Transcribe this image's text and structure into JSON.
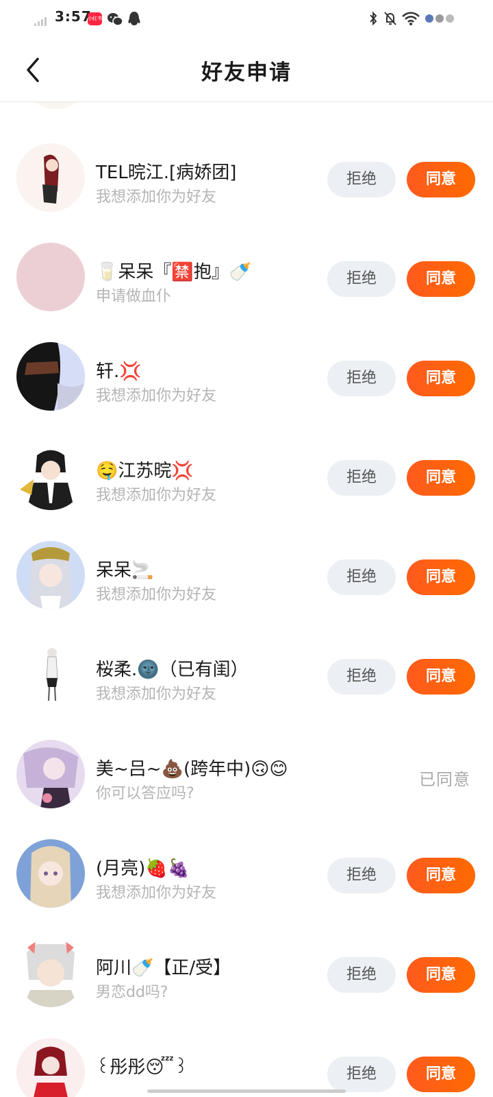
{
  "status_bar": {
    "time": "3:57",
    "app_icon_text": "小红书"
  },
  "header": {
    "title": "好友申请"
  },
  "requests": [
    {
      "name": "TEL晥江.[病娇团]",
      "message": "我想添加你为好友",
      "reject_label": "拒绝",
      "accept_label": "同意"
    },
    {
      "name": "🥛呆呆『🈲抱』🍼",
      "message": "申请做血仆",
      "reject_label": "拒绝",
      "accept_label": "同意"
    },
    {
      "name": "轩.💢",
      "message": "我想添加你为好友",
      "reject_label": "拒绝",
      "accept_label": "同意"
    },
    {
      "name": "🤤江苏晥💢",
      "message": "我想添加你为好友",
      "reject_label": "拒绝",
      "accept_label": "同意"
    },
    {
      "name": "呆呆🚬",
      "message": "我想添加你为好友",
      "reject_label": "拒绝",
      "accept_label": "同意"
    },
    {
      "name": "桜柔.🌚（已有闺）",
      "message": "我想添加你为好友",
      "reject_label": "拒绝",
      "accept_label": "同意"
    },
    {
      "name": "美~吕~💩(跨年中)🙃😊",
      "message": "你可以答应吗?",
      "status_label": "已同意"
    },
    {
      "name": "(月亮)🍓🍇",
      "message": "我想添加你为好友",
      "reject_label": "拒绝",
      "accept_label": "同意"
    },
    {
      "name": "阿川🍼【正/受】",
      "message": "男恋dd吗?",
      "reject_label": "拒绝",
      "accept_label": "同意"
    },
    {
      "name": "꒰彤彤😴꒱",
      "message": "",
      "reject_label": "拒绝",
      "accept_label": "同意"
    }
  ],
  "colors": {
    "accept_button": "#ff5a1f",
    "reject_button": "#eceff4",
    "secondary_text": "#b4b4b4"
  }
}
